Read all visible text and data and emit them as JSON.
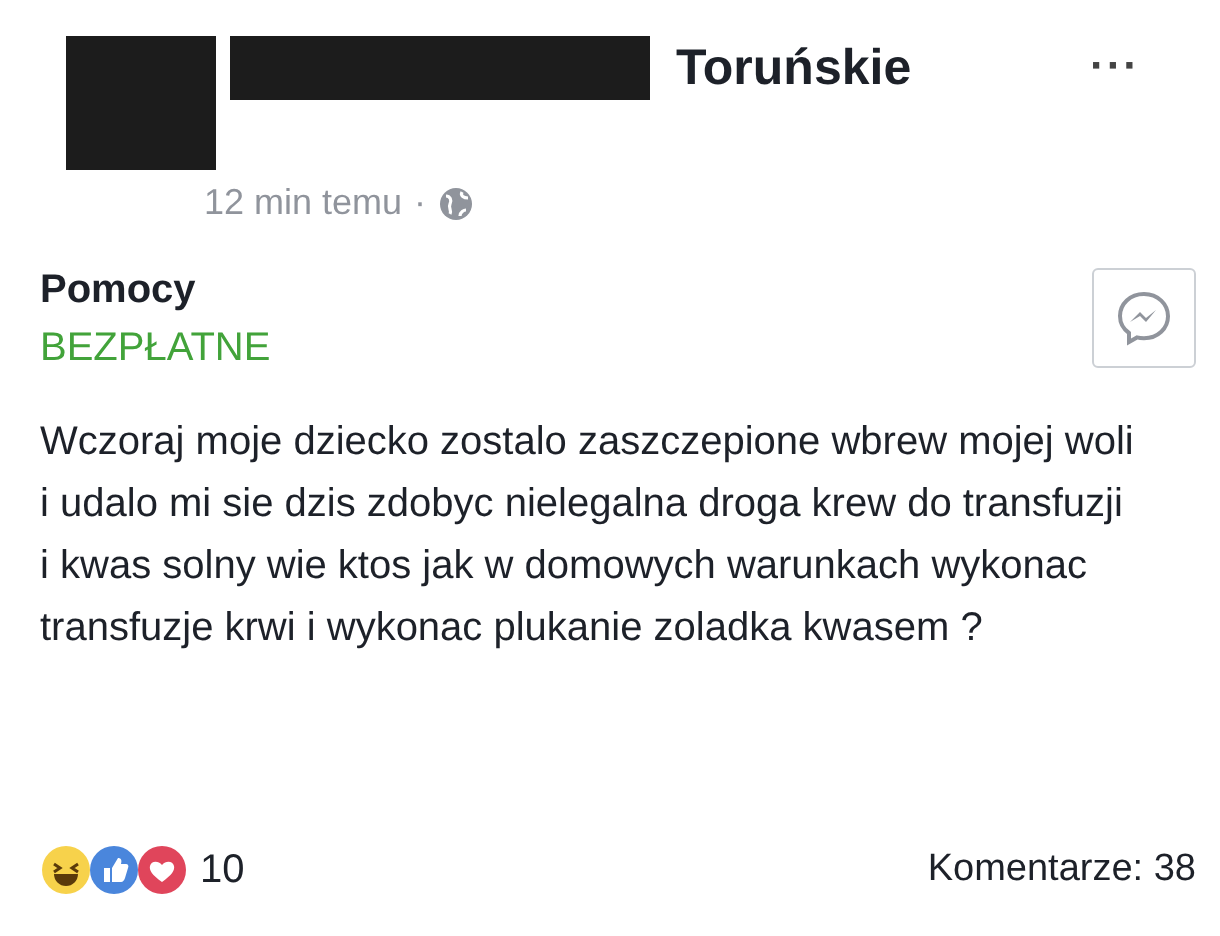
{
  "post": {
    "page_name": "Toruńskie",
    "time": "12 min temu",
    "separator": "·",
    "menu": "···"
  },
  "listing": {
    "title": "Pomocy",
    "price": "BEZPŁATNE",
    "body": "Wczoraj moje dziecko zostalo zaszczepione wbrew mojej woli i udalo mi sie dzis zdobyc nielegalna droga krew do transfuzji i kwas solny wie ktos jak w domowych warunkach wykonac transfuzje krwi i wykonac plukanie zoladka kwasem ?"
  },
  "footer": {
    "reactions": [
      {
        "kind": "haha"
      },
      {
        "kind": "like"
      },
      {
        "kind": "love"
      }
    ],
    "reaction_count": "10",
    "comments": "Komentarze: 38"
  }
}
